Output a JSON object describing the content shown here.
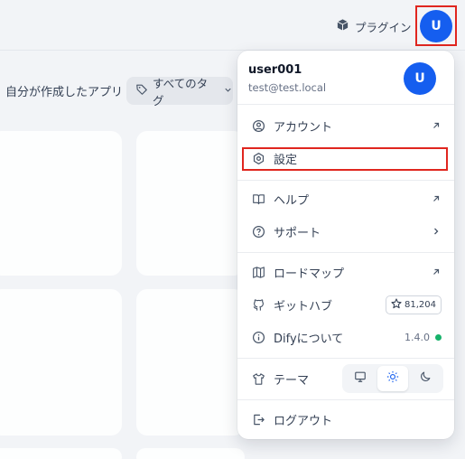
{
  "topbar": {
    "plugin_label": "プラグイン",
    "avatar_initial": "U"
  },
  "filter": {
    "created_by_me_label": "自分が作成したアプリ",
    "tag_label": "すべてのタグ"
  },
  "menu": {
    "username": "user001",
    "email": "test@test.local",
    "avatar_initial": "U",
    "account": "アカウント",
    "settings": "設定",
    "help": "ヘルプ",
    "support": "サポート",
    "roadmap": "ロードマップ",
    "github": "ギットハブ",
    "github_stars": "81,204",
    "about": "Difyについて",
    "version": "1.4.0",
    "theme": "テーマ",
    "logout": "ログアウト"
  },
  "colors": {
    "accent": "#155eef",
    "highlight_border": "#e0261f",
    "status_ok": "#17b26a"
  },
  "icons": [
    "package-icon",
    "chevron-down-icon",
    "tag-icon",
    "user-circle-icon",
    "settings-icon",
    "book-icon",
    "help-circle-icon",
    "map-icon",
    "github-icon",
    "info-icon",
    "shirt-icon",
    "monitor-icon",
    "sun-icon",
    "moon-icon",
    "logout-icon",
    "arrow-up-right-icon",
    "chevron-right-icon",
    "star-icon"
  ]
}
